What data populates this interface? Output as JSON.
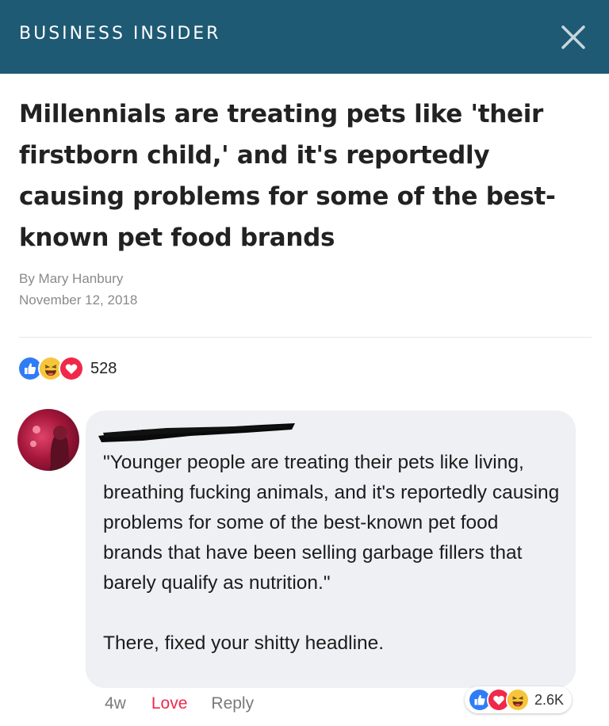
{
  "header": {
    "brand": "BUSINESS INSIDER",
    "close_icon": "close-icon",
    "background_color": "#1e5a73"
  },
  "article": {
    "headline": "Millennials are treating pets like 'their firstborn child,' and it's reportedly causing problems for some of the best-known pet food brands",
    "byline": "By Mary Hanbury",
    "date": "November 12, 2018"
  },
  "post_reactions": {
    "icons": [
      "like-icon",
      "haha-icon",
      "love-icon"
    ],
    "count": "528"
  },
  "comment": {
    "avatar_icon": "avatar",
    "author_redacted": true,
    "text": "\"Younger people are treating their pets like living, breathing fucking animals, and it's reportedly causing problems for some of the best-known pet food brands that have been selling garbage fillers that barely qualify as nutrition.\"\n\nThere, fixed your shitty headline.",
    "time": "4w",
    "love_label": "Love",
    "reply_label": "Reply",
    "reactions": {
      "icons": [
        "like-icon",
        "love-icon",
        "haha-icon"
      ],
      "count": "2.6K"
    },
    "love_color": "#f0284a"
  }
}
